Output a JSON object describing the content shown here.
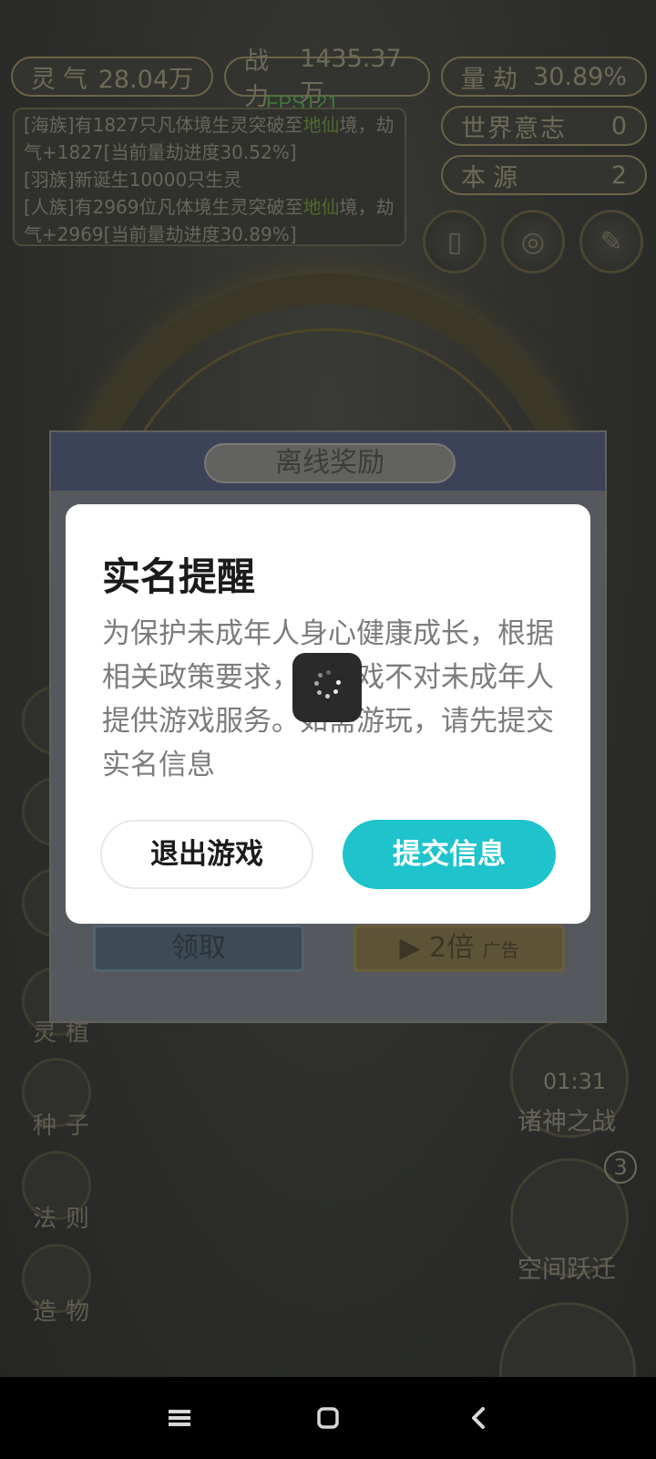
{
  "stats": {
    "lingqi_label": "灵气",
    "lingqi_value": "28.04万",
    "zhanli_label": "战力",
    "zhanli_value": "1435.37万",
    "liangjie_label": "量劫",
    "liangjie_value": "30.89%",
    "shijie_label": "世界意志",
    "shijie_value": "0",
    "benyuan_label": "本源",
    "benyuan_value": "2"
  },
  "fps": "FPS121",
  "log": {
    "line1a": "[海族]有1827只凡体境生灵突破至",
    "line1b": "地仙",
    "line1c": "境，劫气+1827[当前量劫进度30.52%]",
    "line2": "[羽族]新诞生10000只生灵",
    "line3a": "[人族]有2969位凡体境生灵突破至",
    "line3b": "地仙",
    "line3c": "境，劫气+2969[当前量劫进度30.89%]"
  },
  "side_menu": [
    "灵植",
    "种子",
    "法则",
    "造物"
  ],
  "right_menu": {
    "timer": "01:31",
    "gods_war": "诸神之战",
    "space_jump": "空间跃迁",
    "badge": "3"
  },
  "reward_panel": {
    "title": "离线奖励",
    "collect_label": "领取",
    "double_label": "▶ 2倍",
    "ad_tag": "广告"
  },
  "dialog": {
    "title": "实名提醒",
    "body": "为保护未成年人身心健康成长，根据相关政策要求，该游戏不对未成年人提供游戏服务。如需游玩，请先提交实名信息",
    "exit_label": "退出游戏",
    "submit_label": "提交信息"
  },
  "colors": {
    "accent": "#1ec3cc",
    "dialog_bg": "#ffffff",
    "overlay": "#2c2d2b"
  },
  "navbar": {
    "icons": [
      "menu-icon",
      "home-icon",
      "back-icon"
    ]
  }
}
